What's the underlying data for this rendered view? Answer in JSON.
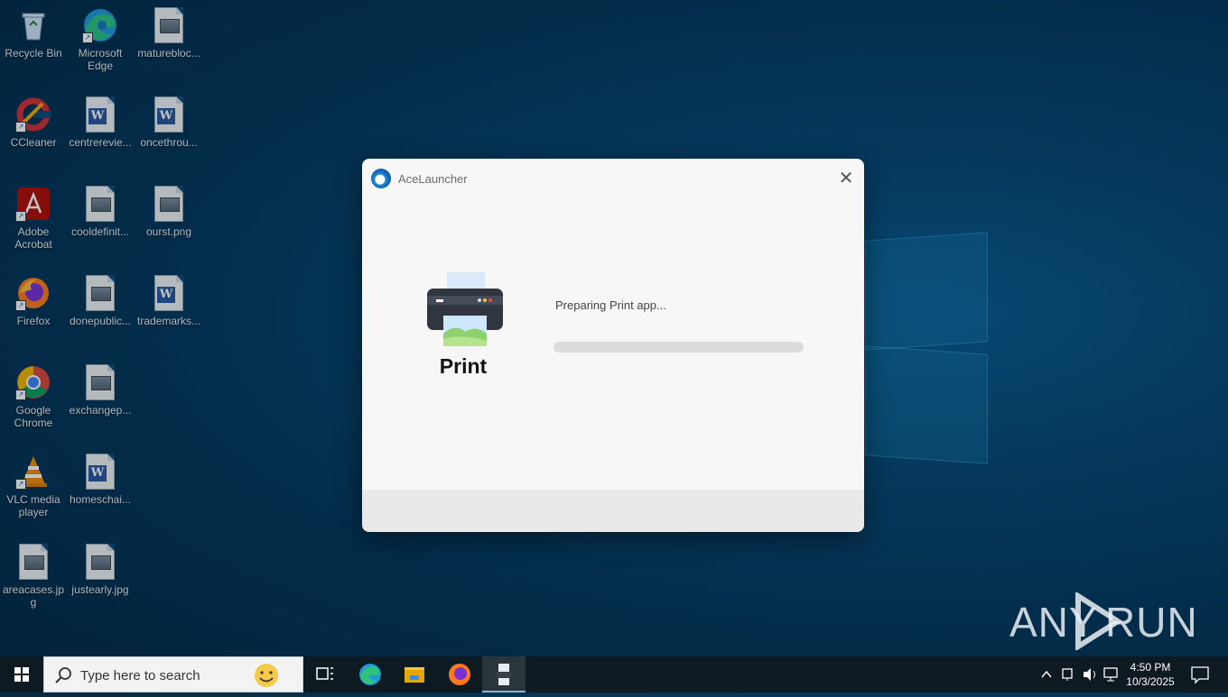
{
  "desktop": {
    "icons": [
      {
        "label": "Recycle Bin",
        "icon": "recycle-bin-icon"
      },
      {
        "label": "Microsoft Edge",
        "icon": "edge-icon"
      },
      {
        "label": "maturebloc...",
        "icon": "image-file-icon"
      },
      {
        "label": "CCleaner",
        "icon": "ccleaner-icon"
      },
      {
        "label": "centrerevie...",
        "icon": "word-doc-icon"
      },
      {
        "label": "oncethrou...",
        "icon": "word-doc-icon"
      },
      {
        "label": "Adobe Acrobat",
        "icon": "acrobat-icon"
      },
      {
        "label": "cooldefinit...",
        "icon": "image-file-icon"
      },
      {
        "label": "ourst.png",
        "icon": "image-file-icon"
      },
      {
        "label": "Firefox",
        "icon": "firefox-icon"
      },
      {
        "label": "donepublic...",
        "icon": "image-file-icon"
      },
      {
        "label": "trademarks...",
        "icon": "word-doc-icon"
      },
      {
        "label": "Google Chrome",
        "icon": "chrome-icon"
      },
      {
        "label": "exchangep...",
        "icon": "image-file-icon"
      },
      {
        "label": "VLC media player",
        "icon": "vlc-icon"
      },
      {
        "label": "homeschai...",
        "icon": "word-doc-icon"
      },
      {
        "label": "areacases.jpg",
        "icon": "image-file-icon"
      },
      {
        "label": "justearly.jpg",
        "icon": "image-file-icon"
      }
    ]
  },
  "dialog": {
    "title": "AceLauncher",
    "app_name": "Print",
    "status": "Preparing Print app...",
    "progress": 0,
    "accent": "#1e88d8"
  },
  "watermark": {
    "left": "ANY",
    "right": "RUN"
  },
  "taskbar": {
    "search_placeholder": "Type here to search",
    "apps": [
      "task-view-icon",
      "edge-icon",
      "file-explorer-icon",
      "firefox-icon",
      "printer-app-icon"
    ],
    "time": "4:50 PM",
    "date": "10/3/2025"
  }
}
